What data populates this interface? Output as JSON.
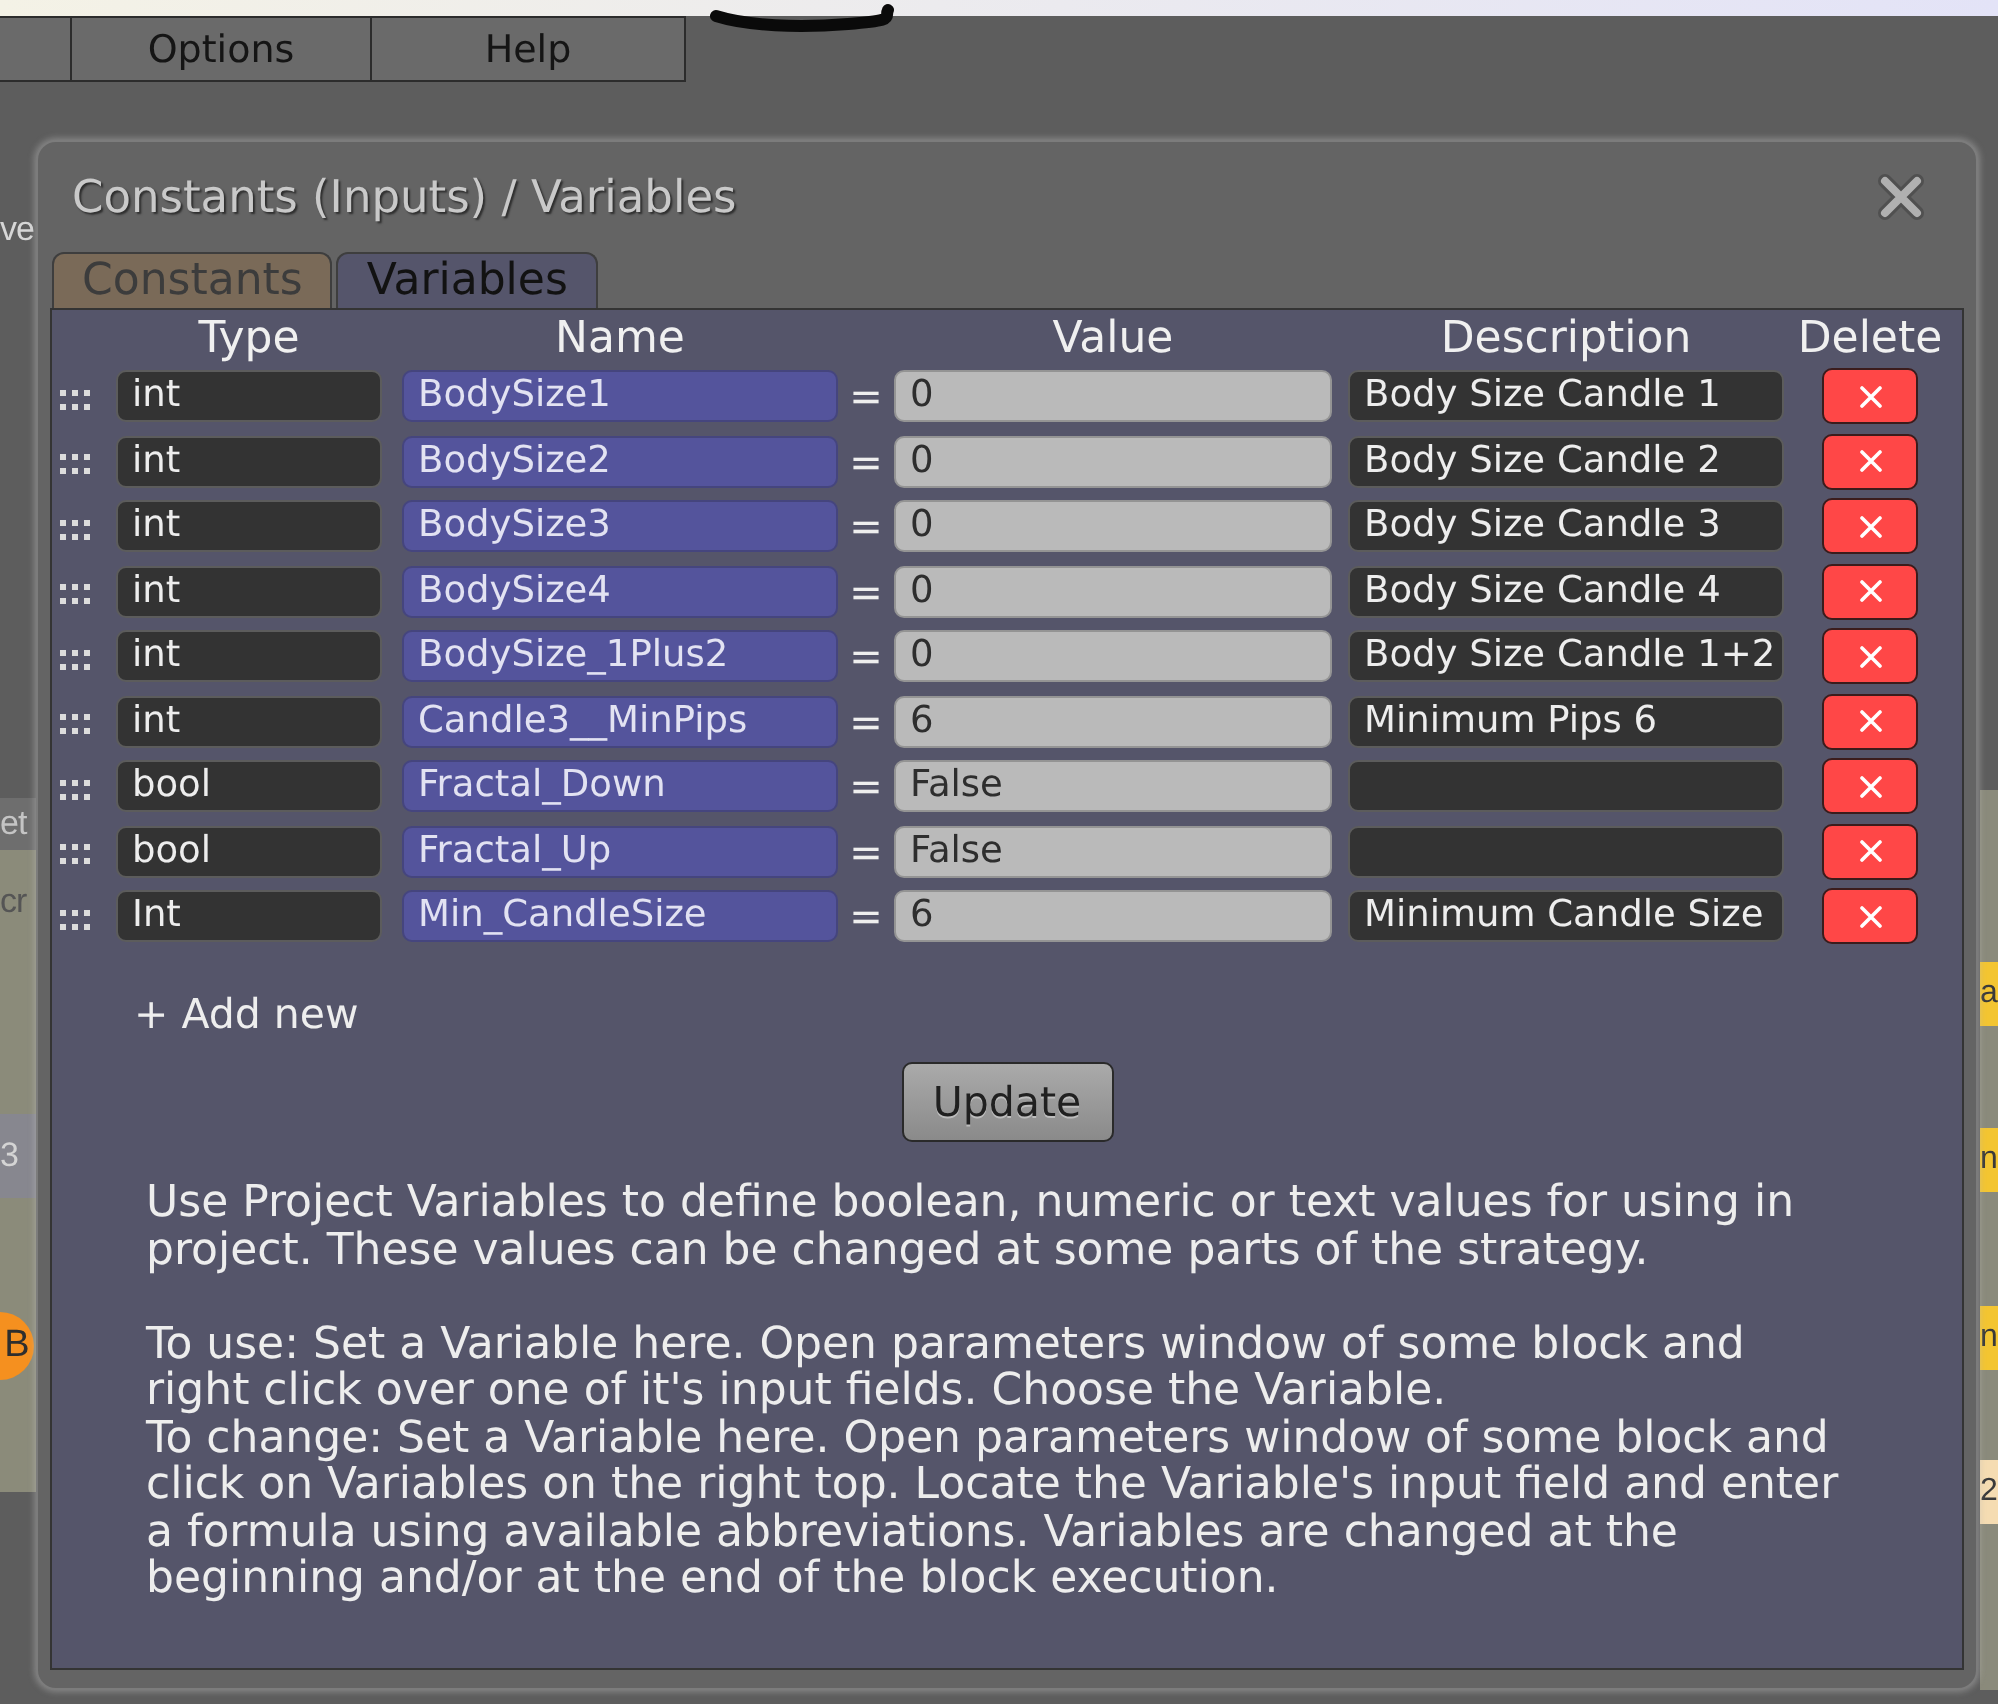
{
  "background": {
    "menu_items": [
      "Options",
      "Help"
    ],
    "left_fragments": [
      {
        "text": "ve",
        "kind": "plain"
      },
      {
        "text": "et",
        "kind": "panel"
      },
      {
        "text": "cr",
        "kind": "panel"
      },
      {
        "text": "3",
        "kind": "panel"
      },
      {
        "text": "B",
        "kind": "badge"
      }
    ],
    "right_fragments": [
      {
        "text": "a",
        "kind": "tag"
      },
      {
        "text": "n",
        "kind": "tag"
      },
      {
        "text": "n",
        "kind": "tag"
      },
      {
        "text": "2",
        "kind": "pale-tag"
      }
    ]
  },
  "dialog": {
    "title": "Constants (Inputs) / Variables",
    "tabs": [
      {
        "label": "Constants",
        "selected": false
      },
      {
        "label": "Variables",
        "selected": true
      }
    ],
    "table": {
      "columns": [
        "Type",
        "Name",
        "Value",
        "Description",
        "Delete"
      ],
      "rows": [
        {
          "type": "int",
          "name": "BodySize1",
          "operator": "=",
          "value": "0",
          "description": "Body Size Candle 1"
        },
        {
          "type": "int",
          "name": "BodySize2",
          "operator": "=",
          "value": "0",
          "description": "Body Size Candle 2"
        },
        {
          "type": "int",
          "name": "BodySize3",
          "operator": "=",
          "value": "0",
          "description": "Body Size Candle 3"
        },
        {
          "type": "int",
          "name": "BodySize4",
          "operator": "=",
          "value": "0",
          "description": "Body Size Candle 4"
        },
        {
          "type": "int",
          "name": "BodySize_1Plus2",
          "operator": "=",
          "value": "0",
          "description": "Body Size Candle 1+2"
        },
        {
          "type": "int",
          "name": "Candle3__MinPips",
          "operator": "=",
          "value": "6",
          "description": "Minimum Pips 6"
        },
        {
          "type": "bool",
          "name": "Fractal_Down",
          "operator": "=",
          "value": "False"
        },
        {
          "type": "bool",
          "name": "Fractal_Up",
          "operator": "=",
          "value": "False"
        },
        {
          "type": "Int",
          "name": "Min_CandleSize",
          "operator": "=",
          "value": "6",
          "description": "Minimum Candle Size"
        }
      ]
    },
    "add_new": "+ Add new",
    "update_button": "Update",
    "help_sections": [
      [
        "Use Project Variables to define boolean, numeric or text values for using in project. These values can be changed at some parts of the strategy."
      ],
      [
        "To use: Set a Variable here. Open parameters window of some block and right click over one of it's input fields. Choose the Variable.",
        "To change: Set a Variable here. Open parameters window of some block and click on Variables on the right top. Locate the Variable's input field and enter a formula using available abbreviations. Variables are changed at the beginning and/or at the end of the block execution."
      ]
    ]
  }
}
